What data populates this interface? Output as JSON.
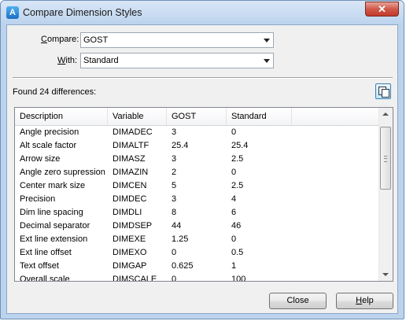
{
  "window": {
    "title": "Compare Dimension Styles",
    "close_glyph": "✕",
    "app_icon": "autocad-icon"
  },
  "compare": {
    "label_pre": "",
    "label_key": "C",
    "label_post": "ompare:",
    "value": "GOST"
  },
  "with": {
    "label_pre": "",
    "label_key": "W",
    "label_post": "ith:",
    "value": "Standard"
  },
  "results": {
    "summary": "Found 24 differences:",
    "copy_icon": "copy-to-clipboard-icon"
  },
  "table": {
    "columns": [
      "Description",
      "Variable",
      "GOST",
      "Standard"
    ],
    "rows": [
      [
        "Angle precision",
        "DIMADEC",
        "3",
        "0"
      ],
      [
        "Alt scale factor",
        "DIMALTF",
        "25.4",
        "25.4"
      ],
      [
        "Arrow size",
        "DIMASZ",
        "3",
        "2.5"
      ],
      [
        "Angle zero supression",
        "DIMAZIN",
        "2",
        "0"
      ],
      [
        "Center mark size",
        "DIMCEN",
        "5",
        "2.5"
      ],
      [
        "Precision",
        "DIMDEC",
        "3",
        "4"
      ],
      [
        "Dim line spacing",
        "DIMDLI",
        "8",
        "6"
      ],
      [
        "Decimal separator",
        "DIMDSEP",
        "44",
        "46"
      ],
      [
        "Ext line extension",
        "DIMEXE",
        "1.25",
        "0"
      ],
      [
        "Ext line offset",
        "DIMEXO",
        "0",
        "0.5"
      ],
      [
        "Text offset",
        "DIMGAP",
        "0.625",
        "1"
      ],
      [
        "Overall scale",
        "DIMSCALE",
        "0",
        "100"
      ]
    ]
  },
  "buttons": {
    "close": {
      "label": "Close"
    },
    "help": {
      "label_pre": "",
      "label_key": "H",
      "label_post": "elp"
    }
  }
}
